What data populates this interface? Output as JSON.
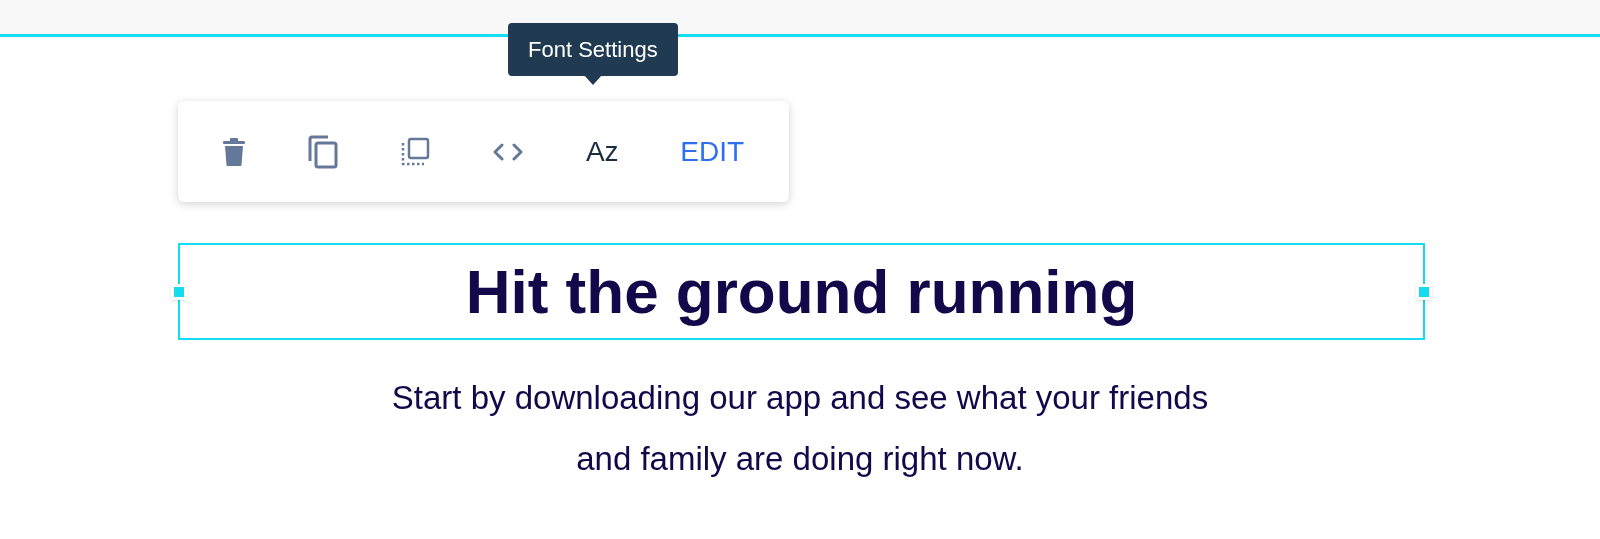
{
  "tooltip": {
    "text": "Font Settings"
  },
  "toolbar": [
    {
      "kind": "trash"
    },
    {
      "kind": "copy"
    },
    {
      "kind": "frame"
    },
    {
      "kind": "code"
    },
    {
      "kind": "text",
      "label": "Az"
    },
    {
      "kind": "link",
      "label": "EDIT"
    }
  ],
  "heading": {
    "text": "Hit the ground running",
    "selected": true
  },
  "paragraph": {
    "lines": [
      "Start by downloading our app and see what your friends",
      "and family are doing right now."
    ]
  }
}
